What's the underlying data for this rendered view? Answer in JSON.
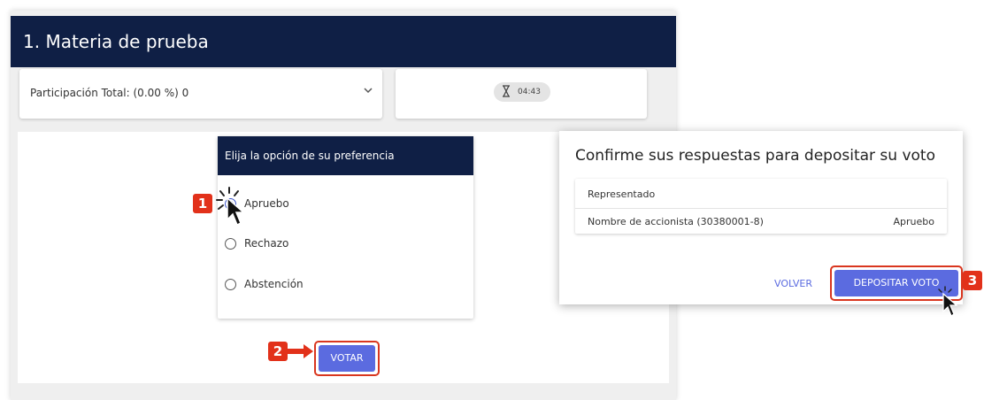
{
  "panel": {
    "title": "1. Materia de prueba",
    "participation_label": "Participación Total: (0.00 %) 0",
    "timer": "04:43"
  },
  "options_card": {
    "title": "Elija la opción de su preferencia",
    "options": [
      {
        "label": "Apruebo",
        "selected": true
      },
      {
        "label": "Rechazo",
        "selected": false
      },
      {
        "label": "Abstención",
        "selected": false
      }
    ]
  },
  "vote_button": "VOTAR",
  "dialog": {
    "title": "Confirme sus respuestas para depositar su voto",
    "table_header": "Representado",
    "row_name": "Nombre de accionista (30380001-8)",
    "row_answer": "Apruebo",
    "back_button": "VOLVER",
    "deposit_button": "DEPOSITAR VOTO"
  },
  "steps": [
    "1",
    "2",
    "3"
  ],
  "colors": {
    "header_bg": "#0f1f45",
    "primary": "#5b6be0",
    "highlight": "#d9361f"
  }
}
